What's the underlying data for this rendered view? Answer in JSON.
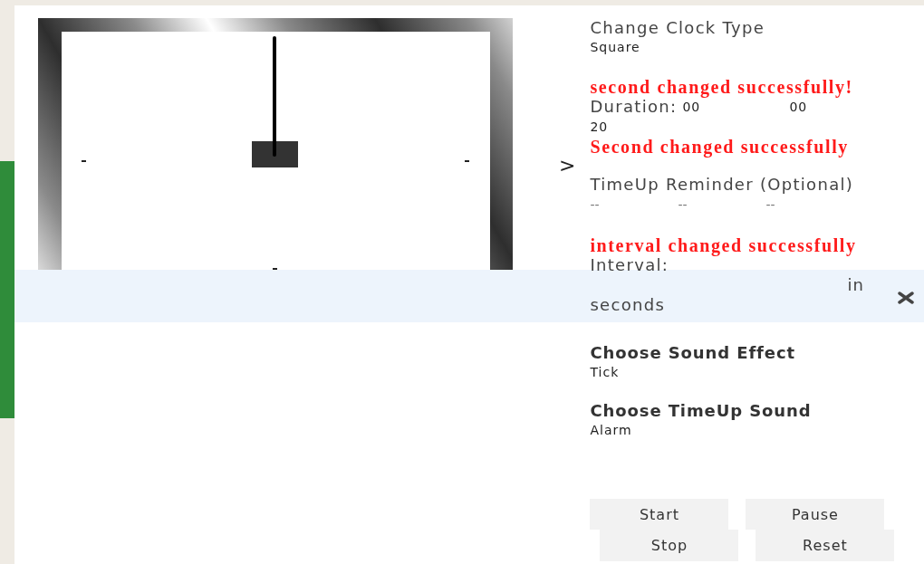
{
  "expand_toggle": ">",
  "sections": [
    {
      "kind": "select",
      "label": "Change Clock Type",
      "value": "Square"
    },
    {
      "kind": "message",
      "text": "second changed successfully!"
    },
    {
      "kind": "inline_fields",
      "label": "Duration:",
      "values": [
        "00",
        "00",
        "20"
      ]
    },
    {
      "kind": "message",
      "text": "Second changed successfully"
    },
    {
      "kind": "stacked_fields",
      "label": "TimeUp Reminder (Optional)",
      "values": [
        "--",
        "--",
        "--"
      ]
    },
    {
      "kind": "message",
      "text": "interval changed successfully"
    },
    {
      "kind": "interval",
      "label": "Interval:",
      "unit_prefix": "in",
      "unit": "seconds"
    },
    {
      "kind": "sound_select",
      "label": "Choose Sound Effect",
      "value": "Tick"
    },
    {
      "kind": "sound_select",
      "label": "Choose TimeUp Sound",
      "value": "Alarm"
    }
  ],
  "buttons": [
    "Start",
    "Pause",
    "Stop",
    "Reset"
  ]
}
